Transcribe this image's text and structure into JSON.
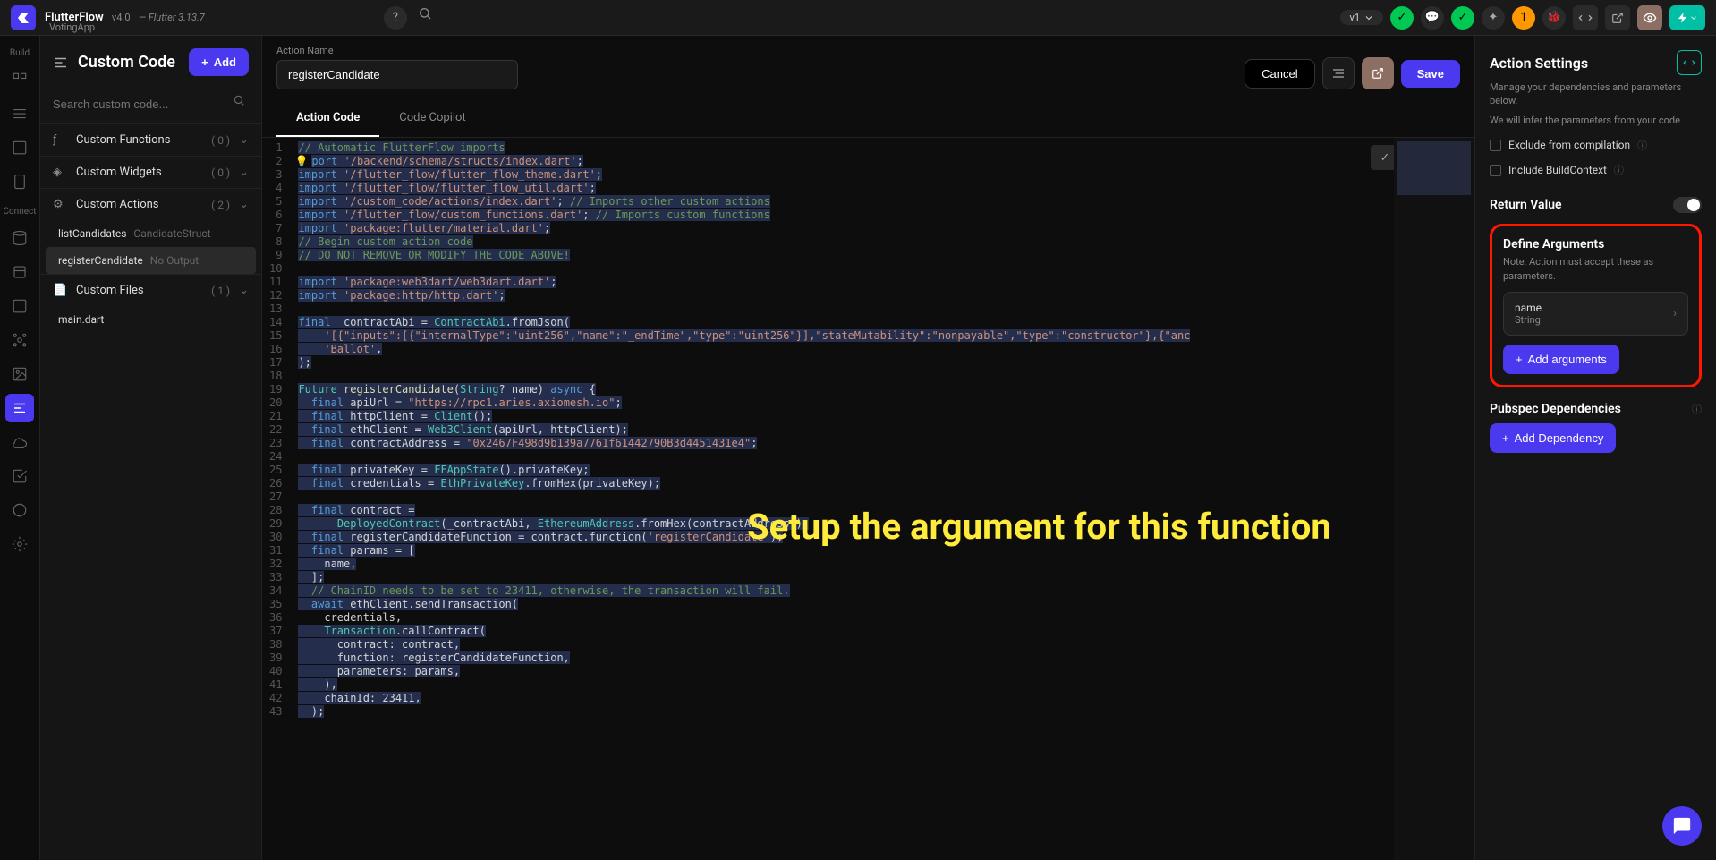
{
  "topbar": {
    "app": "FlutterFlow",
    "version": "v4.0",
    "flutter_ver": "— Flutter 3.13.7",
    "project": "VotingApp",
    "branch": "v1"
  },
  "leftpanel": {
    "title": "Custom Code",
    "add_label": "Add",
    "search_placeholder": "Search custom code...",
    "sections": [
      {
        "title": "Custom Functions",
        "count": "( 0 )"
      },
      {
        "title": "Custom Widgets",
        "count": "( 0 )"
      },
      {
        "title": "Custom Actions",
        "count": "( 2 )"
      },
      {
        "title": "Custom Files",
        "count": "( 1 )"
      }
    ],
    "actions": [
      {
        "name": "listCandidates",
        "meta": "CandidateStruct"
      },
      {
        "name": "registerCandidate",
        "meta": "No Output"
      }
    ],
    "files": [
      {
        "name": "main.dart"
      }
    ]
  },
  "rail": {
    "build": "Build",
    "connect": "Connect"
  },
  "center": {
    "action_name_label": "Action Name",
    "action_name_value": "registerCandidate",
    "cancel": "Cancel",
    "save": "Save",
    "tabs": [
      "Action Code",
      "Code Copilot"
    ]
  },
  "code": {
    "lines": [
      [
        [
          "c-comment",
          "// Automatic FlutterFlow imports"
        ]
      ],
      [
        [
          "c-keyword",
          "port "
        ],
        [
          "c-string",
          "'/backend/schema/structs/index.dart'"
        ],
        [
          "c-text",
          ";"
        ]
      ],
      [
        [
          "c-keyword",
          "import "
        ],
        [
          "c-string",
          "'/flutter_flow/flutter_flow_theme.dart'"
        ],
        [
          "c-text",
          ";"
        ]
      ],
      [
        [
          "c-keyword",
          "import "
        ],
        [
          "c-string",
          "'/flutter_flow/flutter_flow_util.dart'"
        ],
        [
          "c-text",
          ";"
        ]
      ],
      [
        [
          "c-keyword",
          "import "
        ],
        [
          "c-string",
          "'/custom_code/actions/index.dart'"
        ],
        [
          "c-text",
          "; "
        ],
        [
          "c-comment",
          "// Imports other custom actions"
        ]
      ],
      [
        [
          "c-keyword",
          "import "
        ],
        [
          "c-string",
          "'/flutter_flow/custom_functions.dart'"
        ],
        [
          "c-text",
          "; "
        ],
        [
          "c-comment",
          "// Imports custom functions"
        ]
      ],
      [
        [
          "c-keyword",
          "import "
        ],
        [
          "c-string",
          "'package:flutter/material.dart'"
        ],
        [
          "c-text",
          ";"
        ]
      ],
      [
        [
          "c-comment",
          "// Begin custom action code"
        ]
      ],
      [
        [
          "c-comment",
          "// DO NOT REMOVE OR MODIFY THE CODE ABOVE!"
        ]
      ],
      [],
      [
        [
          "c-keyword",
          "import "
        ],
        [
          "c-string",
          "'package:web3dart/web3dart.dart'"
        ],
        [
          "c-text",
          ";"
        ]
      ],
      [
        [
          "c-keyword",
          "import "
        ],
        [
          "c-string",
          "'package:http/http.dart'"
        ],
        [
          "c-text",
          ";"
        ]
      ],
      [],
      [
        [
          "c-keyword",
          "final "
        ],
        [
          "c-text",
          "_contractAbi = "
        ],
        [
          "c-type",
          "ContractAbi"
        ],
        [
          "c-text",
          ".fromJson("
        ]
      ],
      [
        [
          "c-text",
          "    "
        ],
        [
          "c-string",
          "'[{\"inputs\":[{\"internalType\":\"uint256\",\"name\":\"_endTime\",\"type\":\"uint256\"}],\"stateMutability\":\"nonpayable\",\"type\":\"constructor\"},{\"anc"
        ]
      ],
      [
        [
          "c-text",
          "    "
        ],
        [
          "c-string",
          "'Ballot'"
        ],
        [
          "c-text",
          ","
        ]
      ],
      [
        [
          "c-text",
          ");"
        ]
      ],
      [],
      [
        [
          "c-type",
          "Future "
        ],
        [
          "c-func",
          "registerCandidate"
        ],
        [
          "c-text",
          "("
        ],
        [
          "c-type",
          "String"
        ],
        [
          "c-text",
          "? name) "
        ],
        [
          "c-keyword",
          "async"
        ],
        [
          "c-text",
          " {"
        ]
      ],
      [
        [
          "c-text",
          "  "
        ],
        [
          "c-keyword",
          "final "
        ],
        [
          "c-text",
          "apiUrl = "
        ],
        [
          "c-string",
          "\"https://rpc1.aries.axiomesh.io\""
        ],
        [
          "c-text",
          ";"
        ]
      ],
      [
        [
          "c-text",
          "  "
        ],
        [
          "c-keyword",
          "final "
        ],
        [
          "c-text",
          "httpClient = "
        ],
        [
          "c-type",
          "Client"
        ],
        [
          "c-text",
          "();"
        ]
      ],
      [
        [
          "c-text",
          "  "
        ],
        [
          "c-keyword",
          "final "
        ],
        [
          "c-text",
          "ethClient = "
        ],
        [
          "c-type",
          "Web3Client"
        ],
        [
          "c-text",
          "(apiUrl, httpClient);"
        ]
      ],
      [
        [
          "c-text",
          "  "
        ],
        [
          "c-keyword",
          "final "
        ],
        [
          "c-text",
          "contractAddress = "
        ],
        [
          "c-string",
          "\"0x2467F498d9b139a7761f61442790B3d4451431e4\""
        ],
        [
          "c-text",
          ";"
        ]
      ],
      [],
      [
        [
          "c-text",
          "  "
        ],
        [
          "c-keyword",
          "final "
        ],
        [
          "c-text",
          "privateKey = "
        ],
        [
          "c-type",
          "FFAppState"
        ],
        [
          "c-text",
          "().privateKey;"
        ]
      ],
      [
        [
          "c-text",
          "  "
        ],
        [
          "c-keyword",
          "final "
        ],
        [
          "c-text",
          "credentials = "
        ],
        [
          "c-type",
          "EthPrivateKey"
        ],
        [
          "c-text",
          ".fromHex(privateKey);"
        ]
      ],
      [],
      [
        [
          "c-text",
          "  "
        ],
        [
          "c-keyword",
          "final "
        ],
        [
          "c-text",
          "contract ="
        ]
      ],
      [
        [
          "c-text",
          "      "
        ],
        [
          "c-type",
          "DeployedContract"
        ],
        [
          "c-text",
          "(_contractAbi, "
        ],
        [
          "c-type",
          "EthereumAddress"
        ],
        [
          "c-text",
          ".fromHex(contractAddress));"
        ]
      ],
      [
        [
          "c-text",
          "  "
        ],
        [
          "c-keyword",
          "final "
        ],
        [
          "c-text",
          "registerCandidateFunction = contract.function("
        ],
        [
          "c-string",
          "'registerCandidate'"
        ],
        [
          "c-text",
          ");"
        ]
      ],
      [
        [
          "c-text",
          "  "
        ],
        [
          "c-keyword",
          "final "
        ],
        [
          "c-text",
          "params = ["
        ]
      ],
      [
        [
          "c-text",
          "    name,"
        ]
      ],
      [
        [
          "c-text",
          "  ];"
        ]
      ],
      [
        [
          "c-text",
          "  "
        ],
        [
          "c-comment",
          "// ChainID needs to be set to 23411, otherwise, the transaction will fail."
        ]
      ],
      [
        [
          "c-text",
          "  "
        ],
        [
          "c-keyword",
          "await "
        ],
        [
          "c-text",
          "ethClient.sendTransaction("
        ]
      ],
      [
        [
          "c-text",
          "    credentials,"
        ]
      ],
      [
        [
          "c-text",
          "    "
        ],
        [
          "c-type",
          "Transaction"
        ],
        [
          "c-text",
          ".callContract("
        ]
      ],
      [
        [
          "c-text",
          "      contract: contract,"
        ]
      ],
      [
        [
          "c-text",
          "      function: registerCandidateFunction,"
        ]
      ],
      [
        [
          "c-text",
          "      parameters: params,"
        ]
      ],
      [
        [
          "c-text",
          "    ),"
        ]
      ],
      [
        [
          "c-text",
          "    chainId: 23411,"
        ]
      ],
      [
        [
          "c-text",
          "  );"
        ]
      ]
    ]
  },
  "rightpanel": {
    "title": "Action Settings",
    "desc1": "Manage your dependencies and parameters below.",
    "desc2": "We will infer the parameters from your code.",
    "exclude": "Exclude from compilation",
    "include_ctx": "Include BuildContext",
    "return_value": "Return Value",
    "define_args": "Define Arguments",
    "args_note": "Note: Action must accept these as parameters.",
    "arg_name": "name",
    "arg_type": "String",
    "add_args": "Add arguments",
    "pubspec": "Pubspec Dependencies",
    "add_dep": "Add Dependency"
  },
  "annotation": "Setup the argument for this function"
}
